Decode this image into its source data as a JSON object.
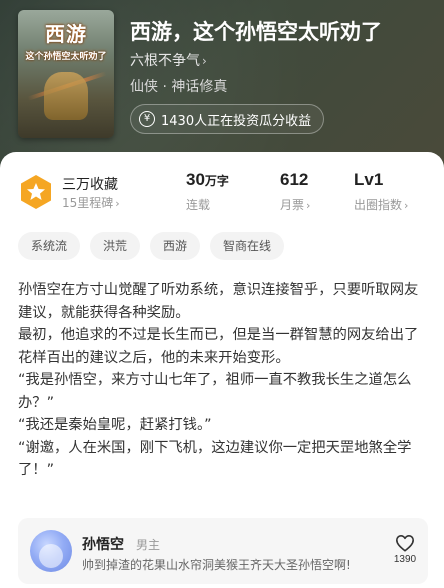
{
  "book": {
    "cover_title_line1": "西游",
    "cover_title_line2": "这个孙悟空太听劝了",
    "title": "西游，这个孙悟空太听劝了",
    "author": "六根不争气",
    "genre": "仙侠 · 神话修真",
    "invest_text": "1430人正在投资瓜分收益"
  },
  "stats": {
    "collect_main": "三万收藏",
    "collect_sub": "15里程碑",
    "words_num": "30",
    "words_unit": "万字",
    "words_label": "连载",
    "monthly_num": "612",
    "monthly_label": "月票",
    "level_num": "Lv1",
    "level_label": "出圈指数"
  },
  "tags": [
    "系统流",
    "洪荒",
    "西游",
    "智商在线"
  ],
  "synopsis": [
    "孙悟空在方寸山觉醒了听劝系统，意识连接智乎，只要听取网友建议，就能获得各种奖励。",
    "最初，他追求的不过是长生而已，但是当一群智慧的网友给出了花样百出的建议之后，他的未来开始变形。",
    "“我是孙悟空，来方寸山七年了，祖师一直不教我长生之道怎么办？”",
    "“我还是秦始皇呢，赶紧打钱。”",
    "“谢邀，人在米国，刚下飞机，这边建议你一定把天罡地煞全学了！”"
  ],
  "character": {
    "name": "孙悟空",
    "role": "男主",
    "desc": "帅到掉渣的花果山水帘洞美猴王齐天大圣孙悟空啊!",
    "likes": "1390"
  },
  "colors": {
    "badge_orange": "#F5A623",
    "hero_bg": "#3a4538"
  },
  "icons": {
    "invest": "yen-circle-icon",
    "badge": "star-hexagon-icon",
    "like": "heart-outline-icon"
  }
}
